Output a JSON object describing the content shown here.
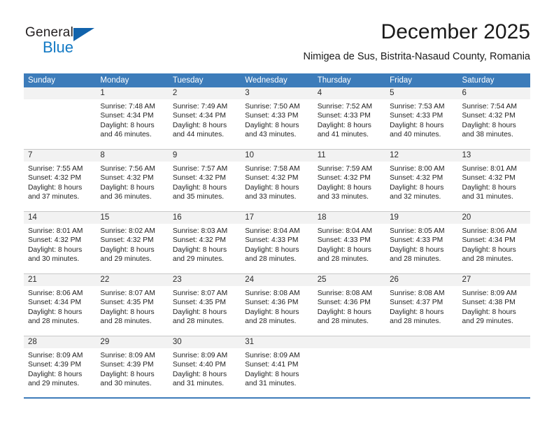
{
  "brand": {
    "name_primary": "General",
    "name_secondary": "Blue",
    "triangle_icon": "triangle-icon",
    "primary_color": "#231f20",
    "secondary_color": "#1279c4"
  },
  "header": {
    "title": "December 2025",
    "subtitle": "Nimigea de Sus, Bistrita-Nasaud County, Romania",
    "header_bg_color": "#3d7cba",
    "day_band_color": "#f2f2f2"
  },
  "weekdays": [
    "Sunday",
    "Monday",
    "Tuesday",
    "Wednesday",
    "Thursday",
    "Friday",
    "Saturday"
  ],
  "weeks": [
    [
      {
        "day": "",
        "lines": []
      },
      {
        "day": "1",
        "lines": [
          "Sunrise: 7:48 AM",
          "Sunset: 4:34 PM",
          "Daylight: 8 hours",
          "and 46 minutes."
        ]
      },
      {
        "day": "2",
        "lines": [
          "Sunrise: 7:49 AM",
          "Sunset: 4:34 PM",
          "Daylight: 8 hours",
          "and 44 minutes."
        ]
      },
      {
        "day": "3",
        "lines": [
          "Sunrise: 7:50 AM",
          "Sunset: 4:33 PM",
          "Daylight: 8 hours",
          "and 43 minutes."
        ]
      },
      {
        "day": "4",
        "lines": [
          "Sunrise: 7:52 AM",
          "Sunset: 4:33 PM",
          "Daylight: 8 hours",
          "and 41 minutes."
        ]
      },
      {
        "day": "5",
        "lines": [
          "Sunrise: 7:53 AM",
          "Sunset: 4:33 PM",
          "Daylight: 8 hours",
          "and 40 minutes."
        ]
      },
      {
        "day": "6",
        "lines": [
          "Sunrise: 7:54 AM",
          "Sunset: 4:32 PM",
          "Daylight: 8 hours",
          "and 38 minutes."
        ]
      }
    ],
    [
      {
        "day": "7",
        "lines": [
          "Sunrise: 7:55 AM",
          "Sunset: 4:32 PM",
          "Daylight: 8 hours",
          "and 37 minutes."
        ]
      },
      {
        "day": "8",
        "lines": [
          "Sunrise: 7:56 AM",
          "Sunset: 4:32 PM",
          "Daylight: 8 hours",
          "and 36 minutes."
        ]
      },
      {
        "day": "9",
        "lines": [
          "Sunrise: 7:57 AM",
          "Sunset: 4:32 PM",
          "Daylight: 8 hours",
          "and 35 minutes."
        ]
      },
      {
        "day": "10",
        "lines": [
          "Sunrise: 7:58 AM",
          "Sunset: 4:32 PM",
          "Daylight: 8 hours",
          "and 33 minutes."
        ]
      },
      {
        "day": "11",
        "lines": [
          "Sunrise: 7:59 AM",
          "Sunset: 4:32 PM",
          "Daylight: 8 hours",
          "and 33 minutes."
        ]
      },
      {
        "day": "12",
        "lines": [
          "Sunrise: 8:00 AM",
          "Sunset: 4:32 PM",
          "Daylight: 8 hours",
          "and 32 minutes."
        ]
      },
      {
        "day": "13",
        "lines": [
          "Sunrise: 8:01 AM",
          "Sunset: 4:32 PM",
          "Daylight: 8 hours",
          "and 31 minutes."
        ]
      }
    ],
    [
      {
        "day": "14",
        "lines": [
          "Sunrise: 8:01 AM",
          "Sunset: 4:32 PM",
          "Daylight: 8 hours",
          "and 30 minutes."
        ]
      },
      {
        "day": "15",
        "lines": [
          "Sunrise: 8:02 AM",
          "Sunset: 4:32 PM",
          "Daylight: 8 hours",
          "and 29 minutes."
        ]
      },
      {
        "day": "16",
        "lines": [
          "Sunrise: 8:03 AM",
          "Sunset: 4:32 PM",
          "Daylight: 8 hours",
          "and 29 minutes."
        ]
      },
      {
        "day": "17",
        "lines": [
          "Sunrise: 8:04 AM",
          "Sunset: 4:33 PM",
          "Daylight: 8 hours",
          "and 28 minutes."
        ]
      },
      {
        "day": "18",
        "lines": [
          "Sunrise: 8:04 AM",
          "Sunset: 4:33 PM",
          "Daylight: 8 hours",
          "and 28 minutes."
        ]
      },
      {
        "day": "19",
        "lines": [
          "Sunrise: 8:05 AM",
          "Sunset: 4:33 PM",
          "Daylight: 8 hours",
          "and 28 minutes."
        ]
      },
      {
        "day": "20",
        "lines": [
          "Sunrise: 8:06 AM",
          "Sunset: 4:34 PM",
          "Daylight: 8 hours",
          "and 28 minutes."
        ]
      }
    ],
    [
      {
        "day": "21",
        "lines": [
          "Sunrise: 8:06 AM",
          "Sunset: 4:34 PM",
          "Daylight: 8 hours",
          "and 28 minutes."
        ]
      },
      {
        "day": "22",
        "lines": [
          "Sunrise: 8:07 AM",
          "Sunset: 4:35 PM",
          "Daylight: 8 hours",
          "and 28 minutes."
        ]
      },
      {
        "day": "23",
        "lines": [
          "Sunrise: 8:07 AM",
          "Sunset: 4:35 PM",
          "Daylight: 8 hours",
          "and 28 minutes."
        ]
      },
      {
        "day": "24",
        "lines": [
          "Sunrise: 8:08 AM",
          "Sunset: 4:36 PM",
          "Daylight: 8 hours",
          "and 28 minutes."
        ]
      },
      {
        "day": "25",
        "lines": [
          "Sunrise: 8:08 AM",
          "Sunset: 4:36 PM",
          "Daylight: 8 hours",
          "and 28 minutes."
        ]
      },
      {
        "day": "26",
        "lines": [
          "Sunrise: 8:08 AM",
          "Sunset: 4:37 PM",
          "Daylight: 8 hours",
          "and 28 minutes."
        ]
      },
      {
        "day": "27",
        "lines": [
          "Sunrise: 8:09 AM",
          "Sunset: 4:38 PM",
          "Daylight: 8 hours",
          "and 29 minutes."
        ]
      }
    ],
    [
      {
        "day": "28",
        "lines": [
          "Sunrise: 8:09 AM",
          "Sunset: 4:39 PM",
          "Daylight: 8 hours",
          "and 29 minutes."
        ]
      },
      {
        "day": "29",
        "lines": [
          "Sunrise: 8:09 AM",
          "Sunset: 4:39 PM",
          "Daylight: 8 hours",
          "and 30 minutes."
        ]
      },
      {
        "day": "30",
        "lines": [
          "Sunrise: 8:09 AM",
          "Sunset: 4:40 PM",
          "Daylight: 8 hours",
          "and 31 minutes."
        ]
      },
      {
        "day": "31",
        "lines": [
          "Sunrise: 8:09 AM",
          "Sunset: 4:41 PM",
          "Daylight: 8 hours",
          "and 31 minutes."
        ]
      },
      {
        "day": "",
        "lines": []
      },
      {
        "day": "",
        "lines": []
      },
      {
        "day": "",
        "lines": []
      }
    ]
  ]
}
